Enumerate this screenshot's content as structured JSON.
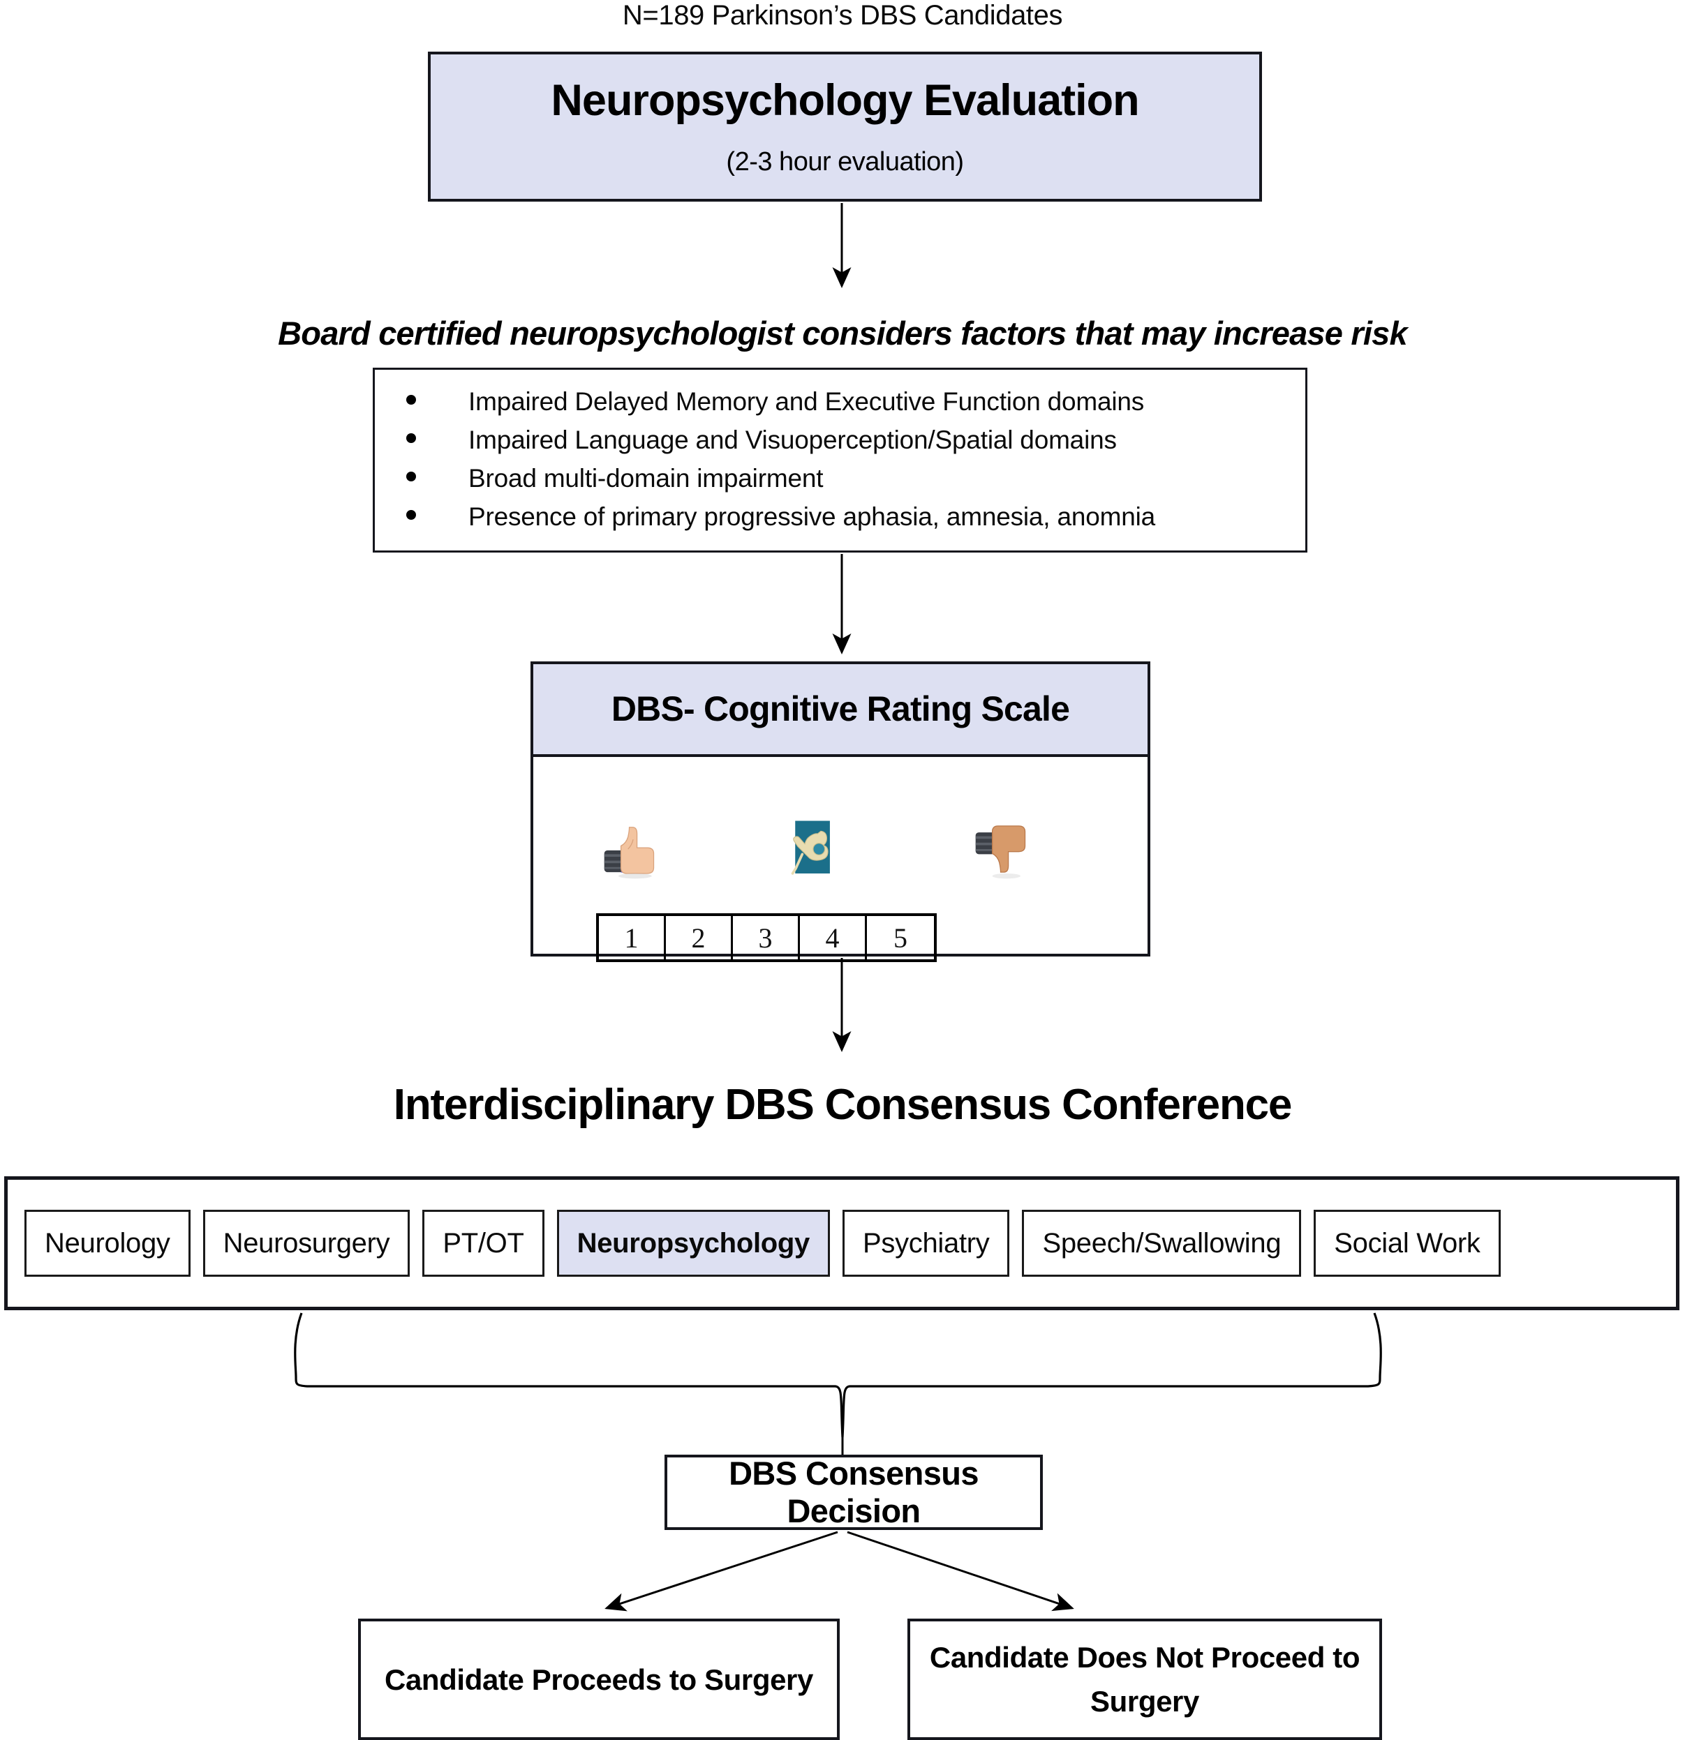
{
  "caption": {
    "cohort": "N=189 Parkinson’s DBS Candidates"
  },
  "colors": {
    "highlight_fill": "#dde0f2",
    "border": "#15161d",
    "neutral_icon_bg": "#1b6f8a"
  },
  "neuropsych_eval": {
    "title": "Neuropsychology Evaluation",
    "subtitle": "(2-3 hour evaluation)"
  },
  "risk_statement": "Board certified neuropsychologist considers factors that may increase risk",
  "risk_factors": [
    "Impaired Delayed Memory and Executive Function domains",
    "Impaired Language and Visuoperception/Spatial domains",
    "Broad multi-domain impairment",
    "Presence of primary progressive aphasia, amnesia, anomnia"
  ],
  "dbs_scale": {
    "title": "DBS- Cognitive Rating Scale",
    "icons": [
      {
        "name": "thumbs-up-icon",
        "glyph": "👍"
      },
      {
        "name": "neutral-hand-icon",
        "glyph": "🤚"
      },
      {
        "name": "thumbs-down-icon",
        "glyph": "👎"
      }
    ],
    "values": [
      "1",
      "2",
      "3",
      "4",
      "5"
    ]
  },
  "conference": {
    "heading": "Interdisciplinary DBS Consensus Conference",
    "disciplines": [
      {
        "label": "Neurology",
        "highlighted": false
      },
      {
        "label": "Neurosurgery",
        "highlighted": false
      },
      {
        "label": "PT/OT",
        "highlighted": false
      },
      {
        "label": "Neuropsychology",
        "highlighted": true
      },
      {
        "label": "Psychiatry",
        "highlighted": false
      },
      {
        "label": "Speech/Swallowing",
        "highlighted": false
      },
      {
        "label": "Social Work",
        "highlighted": false
      }
    ]
  },
  "consensus_decision": {
    "title": "DBS Consensus Decision"
  },
  "outcomes": [
    {
      "title": "Candidate Proceeds to Surgery"
    },
    {
      "title": "Candidate Does Not Proceed to Surgery"
    }
  ]
}
